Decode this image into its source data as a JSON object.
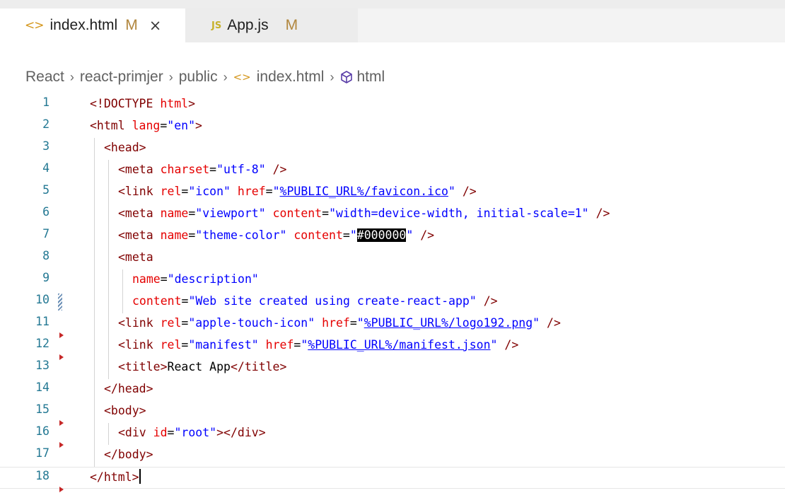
{
  "tabs": [
    {
      "icon": "html-icon",
      "icon_glyph": "<>",
      "name": "index.html",
      "status": "M",
      "close": "×",
      "active": true
    },
    {
      "icon": "js-icon",
      "icon_glyph": "JS",
      "name": "App.js",
      "status": "M",
      "active": false
    }
  ],
  "breadcrumb": {
    "items": [
      "React",
      "react-primjer",
      "public",
      "index.html",
      "html"
    ],
    "separator": "›"
  },
  "editor": {
    "line_numbers": [
      "1",
      "2",
      "3",
      "4",
      "5",
      "6",
      "7",
      "8",
      "9",
      "10",
      "11",
      "12",
      "13",
      "14",
      "15",
      "16",
      "17",
      "18"
    ],
    "current_line": "18",
    "lines": [
      [
        {
          "t": "tag",
          "v": "<!DOCTYPE "
        },
        {
          "t": "attr",
          "v": "html"
        },
        {
          "t": "tag",
          "v": ">"
        }
      ],
      [
        {
          "t": "tag",
          "v": "<html "
        },
        {
          "t": "attr",
          "v": "lang"
        },
        {
          "t": "text",
          "v": "="
        },
        {
          "t": "str",
          "v": "\"en\""
        },
        {
          "t": "tag",
          "v": ">"
        }
      ],
      [
        {
          "t": "tag",
          "v": "<head>"
        }
      ],
      [
        {
          "t": "tag",
          "v": "<meta "
        },
        {
          "t": "attr",
          "v": "charset"
        },
        {
          "t": "text",
          "v": "="
        },
        {
          "t": "str",
          "v": "\"utf-8\""
        },
        {
          "t": "text",
          "v": " "
        },
        {
          "t": "tag",
          "v": "/>"
        }
      ],
      [
        {
          "t": "tag",
          "v": "<link "
        },
        {
          "t": "attr",
          "v": "rel"
        },
        {
          "t": "text",
          "v": "="
        },
        {
          "t": "str",
          "v": "\"icon\""
        },
        {
          "t": "text",
          "v": " "
        },
        {
          "t": "attr",
          "v": "href"
        },
        {
          "t": "text",
          "v": "="
        },
        {
          "t": "str",
          "v": "\""
        },
        {
          "t": "link",
          "v": "%PUBLIC_URL%/favicon.ico"
        },
        {
          "t": "str",
          "v": "\""
        },
        {
          "t": "text",
          "v": " "
        },
        {
          "t": "tag",
          "v": "/>"
        }
      ],
      [
        {
          "t": "tag",
          "v": "<meta "
        },
        {
          "t": "attr",
          "v": "name"
        },
        {
          "t": "text",
          "v": "="
        },
        {
          "t": "str",
          "v": "\"viewport\""
        },
        {
          "t": "text",
          "v": " "
        },
        {
          "t": "attr",
          "v": "content"
        },
        {
          "t": "text",
          "v": "="
        },
        {
          "t": "str",
          "v": "\"width=device-width, initial-scale=1\""
        },
        {
          "t": "text",
          "v": " "
        },
        {
          "t": "tag",
          "v": "/>"
        }
      ],
      [
        {
          "t": "tag",
          "v": "<meta "
        },
        {
          "t": "attr",
          "v": "name"
        },
        {
          "t": "text",
          "v": "="
        },
        {
          "t": "str",
          "v": "\"theme-color\""
        },
        {
          "t": "text",
          "v": " "
        },
        {
          "t": "attr",
          "v": "content"
        },
        {
          "t": "text",
          "v": "="
        },
        {
          "t": "str",
          "v": "\""
        },
        {
          "t": "sel",
          "v": "#000000"
        },
        {
          "t": "str",
          "v": "\""
        },
        {
          "t": "text",
          "v": " "
        },
        {
          "t": "tag",
          "v": "/>"
        }
      ],
      [
        {
          "t": "tag",
          "v": "<meta"
        }
      ],
      [
        {
          "t": "attr",
          "v": "name"
        },
        {
          "t": "text",
          "v": "="
        },
        {
          "t": "str",
          "v": "\"description\""
        }
      ],
      [
        {
          "t": "attr",
          "v": "content"
        },
        {
          "t": "text",
          "v": "="
        },
        {
          "t": "str",
          "v": "\"Web site created using create-react-app\""
        },
        {
          "t": "text",
          "v": " "
        },
        {
          "t": "tag",
          "v": "/>"
        }
      ],
      [
        {
          "t": "tag",
          "v": "<link "
        },
        {
          "t": "attr",
          "v": "rel"
        },
        {
          "t": "text",
          "v": "="
        },
        {
          "t": "str",
          "v": "\"apple-touch-icon\""
        },
        {
          "t": "text",
          "v": " "
        },
        {
          "t": "attr",
          "v": "href"
        },
        {
          "t": "text",
          "v": "="
        },
        {
          "t": "str",
          "v": "\""
        },
        {
          "t": "link",
          "v": "%PUBLIC_URL%/logo192.png"
        },
        {
          "t": "str",
          "v": "\""
        },
        {
          "t": "text",
          "v": " "
        },
        {
          "t": "tag",
          "v": "/>"
        }
      ],
      [
        {
          "t": "tag",
          "v": "<link "
        },
        {
          "t": "attr",
          "v": "rel"
        },
        {
          "t": "text",
          "v": "="
        },
        {
          "t": "str",
          "v": "\"manifest\""
        },
        {
          "t": "text",
          "v": " "
        },
        {
          "t": "attr",
          "v": "href"
        },
        {
          "t": "text",
          "v": "="
        },
        {
          "t": "str",
          "v": "\""
        },
        {
          "t": "link",
          "v": "%PUBLIC_URL%/manifest.json"
        },
        {
          "t": "str",
          "v": "\""
        },
        {
          "t": "text",
          "v": " "
        },
        {
          "t": "tag",
          "v": "/>"
        }
      ],
      [
        {
          "t": "tag",
          "v": "<title>"
        },
        {
          "t": "text",
          "v": "React App"
        },
        {
          "t": "tag",
          "v": "</title>"
        }
      ],
      [
        {
          "t": "tag",
          "v": "</head>"
        }
      ],
      [
        {
          "t": "tag",
          "v": "<body>"
        }
      ],
      [
        {
          "t": "tag",
          "v": "<div "
        },
        {
          "t": "attr",
          "v": "id"
        },
        {
          "t": "text",
          "v": "="
        },
        {
          "t": "str",
          "v": "\"root\""
        },
        {
          "t": "tag",
          "v": "></div>"
        }
      ],
      [
        {
          "t": "tag",
          "v": "</body>"
        }
      ],
      [
        {
          "t": "tag",
          "v": "</html>"
        }
      ]
    ],
    "colors": {
      "tag": "#800000",
      "attribute": "#e50000",
      "string": "#0000ff",
      "line_number": "#237893",
      "selection": "#000000",
      "fold_marker": "#c62828"
    }
  }
}
